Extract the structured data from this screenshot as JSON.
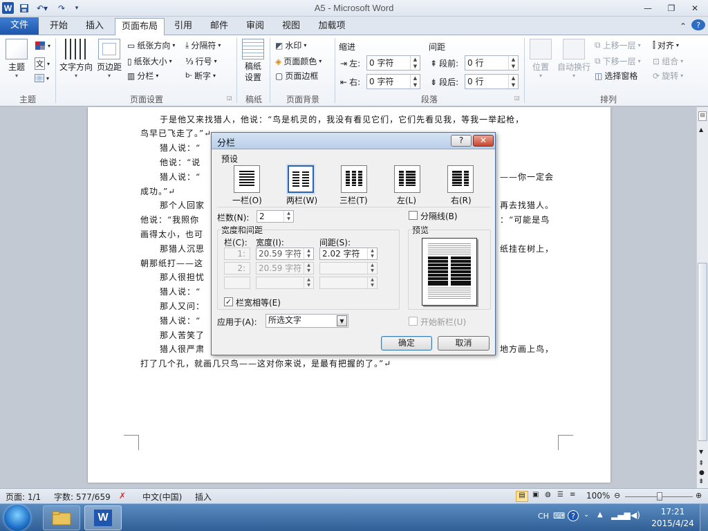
{
  "window": {
    "title": "A5 - Microsoft Word",
    "app_icon": "W"
  },
  "tabs": [
    {
      "label": "文件"
    },
    {
      "label": "开始"
    },
    {
      "label": "插入"
    },
    {
      "label": "页面布局"
    },
    {
      "label": "引用"
    },
    {
      "label": "邮件"
    },
    {
      "label": "审阅"
    },
    {
      "label": "视图"
    },
    {
      "label": "加载项"
    }
  ],
  "ribbon": {
    "theme_group": {
      "label": "主题",
      "theme_button": "主题"
    },
    "page_setup": {
      "label": "页面设置",
      "text_direction": "文字方向",
      "margins": "页边距",
      "orientation": "纸张方向",
      "size": "纸张大小",
      "columns": "分栏",
      "breaks": "分隔符",
      "line_numbers": "行号",
      "hyphenation": "断字"
    },
    "manuscript": {
      "label": "稿纸",
      "setup": "稿纸\n设置"
    },
    "page_background": {
      "label": "页面背景",
      "watermark": "水印",
      "page_color": "页面颜色",
      "page_borders": "页面边框"
    },
    "paragraph": {
      "label": "段落",
      "indent_title": "缩进",
      "spacing_title": "间距",
      "left_label": "左:",
      "left_value": "0 字符",
      "right_label": "右:",
      "right_value": "0 字符",
      "before_label": "段前:",
      "before_value": "0 行",
      "after_label": "段后:",
      "after_value": "0 行"
    },
    "arrange": {
      "label": "排列",
      "position": "位置",
      "wrap": "自动换行",
      "bring_forward": "上移一层",
      "send_backward": "下移一层",
      "selection_pane": "选择窗格",
      "align": "对齐",
      "group": "组合",
      "rotate": "旋转"
    }
  },
  "document": {
    "lines": [
      "于是他又来找猎人，他说：“鸟是机灵的，我没有看见它们，它们先看见我，等我一举起枪，",
      "鸟早已飞走了。”↵",
      "猎人说：“",
      "他说：“说",
      "猎人说：“",
      "成功。”↵",
      "那个人回家",
      "他说：“我照你",
      "画得太小，也可",
      "那猎人沉思",
      "朝那纸打——这",
      "那人很担忧",
      "猎人说：“",
      "那人又问：",
      "猎人说：“",
      "那人苦笑了",
      "猎人很严肃",
      "打了几个孔，就画几只鸟——这对你来说，是最有把握的了。”↵"
    ],
    "right_fragments": [
      "——你一定会",
      "再去找猎人。",
      "：“可能是鸟",
      "纸挂在树上，",
      "地方画上鸟，"
    ]
  },
  "dialog": {
    "title": "分栏",
    "help": "?",
    "close": "✕",
    "presets_title": "预设",
    "presets": [
      {
        "label": "一栏(O)"
      },
      {
        "label": "两栏(W)"
      },
      {
        "label": "三栏(T)"
      },
      {
        "label": "左(L)"
      },
      {
        "label": "右(R)"
      }
    ],
    "col_count_label": "栏数(N):",
    "col_count_value": "2",
    "separator_label": "分隔线(B)",
    "width_spacing_title": "宽度和间距",
    "col_header": "栏(C):",
    "width_header": "宽度(I):",
    "spacing_header": "间距(S):",
    "rows": [
      {
        "num": "1:",
        "width": "20.59 字符",
        "spacing": "2.02 字符"
      },
      {
        "num": "2:",
        "width": "20.59 字符",
        "spacing": ""
      },
      {
        "num": "",
        "width": "",
        "spacing": ""
      }
    ],
    "equal_width_label": "栏宽相等(E)",
    "equal_width_checked": "✓",
    "preview_title": "预览",
    "apply_to_label": "应用于(A):",
    "apply_to_value": "所选文字",
    "new_column_label": "开始新栏(U)",
    "ok": "确定",
    "cancel": "取消"
  },
  "status": {
    "page": "页面: 1/1",
    "words": "字数: 577/659",
    "language": "中文(中国)",
    "mode": "插入",
    "zoom": "100%"
  },
  "taskbar": {
    "ime": "CH",
    "time": "17:21",
    "date": "2015/4/24"
  }
}
